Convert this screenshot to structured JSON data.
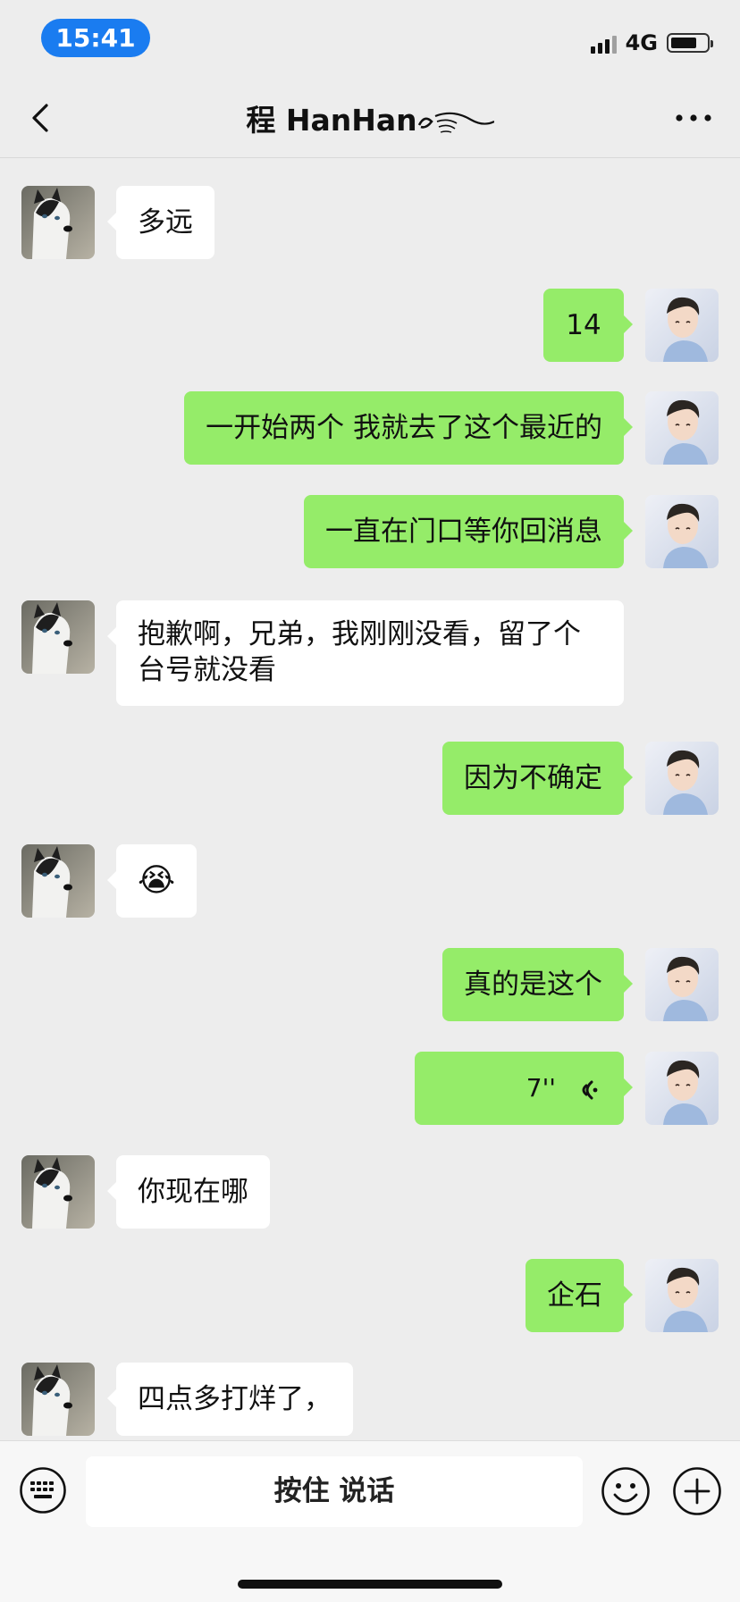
{
  "status_bar": {
    "time": "15:41",
    "network": "4G",
    "battery_level": 0.65,
    "icons": [
      "signal-icon",
      "battery-icon"
    ]
  },
  "header": {
    "title": "程 HanHan",
    "icons": [
      "back-arrow-icon",
      "more-icon"
    ]
  },
  "messages": [
    {
      "from": "them",
      "text": "多远"
    },
    {
      "from": "me",
      "text": "14"
    },
    {
      "from": "me",
      "text": "一开始两个 我就去了这个最近的"
    },
    {
      "from": "me",
      "text": "一直在门口等你回消息"
    },
    {
      "from": "them",
      "text": "抱歉啊，兄弟，我刚刚没看，留了个台号就没看"
    },
    {
      "from": "me",
      "text": "因为不确定"
    },
    {
      "from": "them",
      "text": "😭"
    },
    {
      "from": "me",
      "text": "真的是这个"
    },
    {
      "from": "me",
      "type": "voice",
      "text": "7''"
    },
    {
      "from": "them",
      "text": "你现在哪"
    },
    {
      "from": "me",
      "text": "企石"
    },
    {
      "from": "them",
      "text": "四点多打烊了，"
    }
  ],
  "input_bar": {
    "hold_to_talk": "按住 说话",
    "icons": [
      "keyboard-icon",
      "emoji-icon",
      "plus-icon"
    ]
  },
  "colors": {
    "incoming_bubble": "#ffffff",
    "outgoing_bubble": "#95ec69",
    "background": "#ededed",
    "time_pill": "#1a7cf0"
  }
}
